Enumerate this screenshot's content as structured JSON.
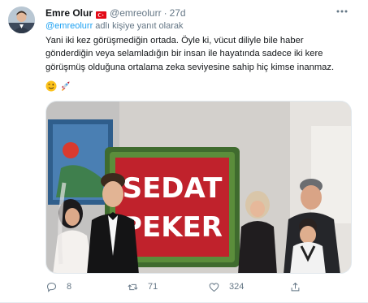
{
  "tweet": {
    "author_name": "Emre Olur",
    "author_handle": "@emreolurr",
    "separator": "·",
    "time": "27d",
    "reply_to": "@emreolurr",
    "reply_suffix": "adlı kişiye yanıt olarak",
    "text_lines": [
      "Yani iki kez görüşmediğin ortada. Öyle ki, vücut diliyle bile haber",
      "gönderdiğin veya selamladığın bir insan ile hayatında sadece iki kere",
      "görüşmüş olduğuna ortalama zeka seviyesine sahip hiç kimse inanmaz."
    ],
    "emojis": [
      "winking-face",
      "rocket"
    ],
    "photo": {
      "sign_line1": "SEDAT",
      "sign_line2": "PEKER"
    },
    "actions": {
      "replies": "8",
      "retweets": "71",
      "likes": "324"
    }
  },
  "colors": {
    "accent": "#1da1f2",
    "muted": "#657786",
    "text": "#14171a",
    "sign_red": "#c0222c"
  }
}
